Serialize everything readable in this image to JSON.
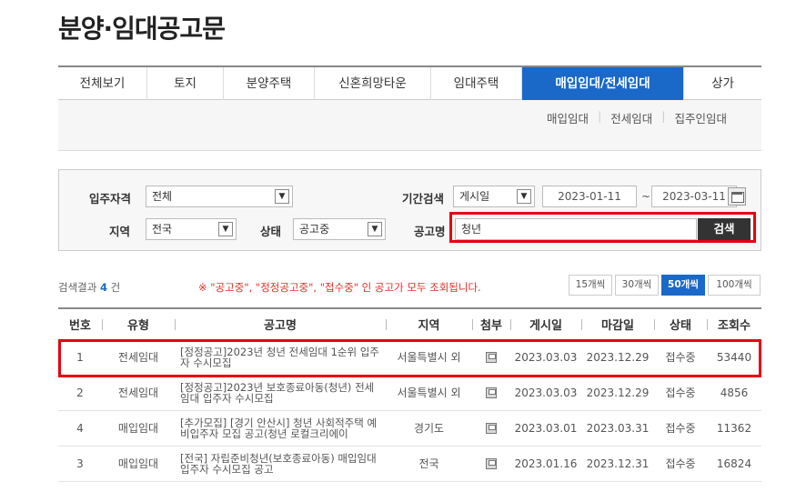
{
  "page_title": "분양·임대공고문",
  "tabs": [
    {
      "label": "전체보기"
    },
    {
      "label": "토지"
    },
    {
      "label": "분양주택"
    },
    {
      "label": "신혼희망타운"
    },
    {
      "label": "임대주택"
    },
    {
      "label": "매입임대/전세임대",
      "active": true
    },
    {
      "label": "상가"
    }
  ],
  "subnav": [
    "매입임대",
    "전세임대",
    "집주인임대"
  ],
  "search": {
    "qualification_label": "입주자격",
    "qualification_value": "전체",
    "period_label": "기간검색",
    "period_type": "게시일",
    "date_from": "2023-01-11",
    "date_sep": "~",
    "date_to": "2023-03-11",
    "region_label": "지역",
    "region_value": "전국",
    "status_label": "상태",
    "status_value": "공고중",
    "keyword_label": "공고명",
    "keyword_value": "청년",
    "button_label": "검색"
  },
  "results": {
    "count_prefix": "검색결과",
    "count": "4",
    "count_suffix": "건",
    "notice": "※ \"공고중\", \"정정공고중\", \"접수중\" 인 공고가 모두 조회됩니다.",
    "per_page": [
      {
        "label": "15개씩"
      },
      {
        "label": "30개씩"
      },
      {
        "label": "50개씩",
        "active": true
      },
      {
        "label": "100개씩"
      }
    ]
  },
  "table": {
    "headers": [
      "번호",
      "유형",
      "공고명",
      "지역",
      "첨부",
      "게시일",
      "마감일",
      "상태",
      "조회수"
    ],
    "rows": [
      {
        "no": "1",
        "type": "전세임대",
        "title": "[정정공고]2023년 청년 전세임대 1순위 입주자 수시모집",
        "region": "서울특별시 외",
        "posted": "2023.03.03",
        "deadline": "2023.12.29",
        "status": "접수중",
        "views": "53440"
      },
      {
        "no": "2",
        "type": "전세임대",
        "title": "[정정공고]2023년 보호종료아동(청년) 전세임대 입주자 수시모집",
        "region": "서울특별시 외",
        "posted": "2023.03.03",
        "deadline": "2023.12.29",
        "status": "접수중",
        "views": "4856"
      },
      {
        "no": "4",
        "type": "매입임대",
        "title": "[추가모집] [경기 안산시] 청년 사회적주택 예비입주자 모집 공고(청년 로컬크리에이",
        "region": "경기도",
        "posted": "2023.03.01",
        "deadline": "2023.03.31",
        "status": "접수중",
        "views": "11362"
      },
      {
        "no": "3",
        "type": "매입임대",
        "title": "[전국] 자립준비청년(보호종료아동) 매입임대 입주자 수시모집 공고",
        "region": "전국",
        "posted": "2023.01.16",
        "deadline": "2023.12.31",
        "status": "접수중",
        "views": "16824"
      }
    ]
  },
  "colors": {
    "accent": "#1a68c8",
    "highlight": "#e60012",
    "notice": "#e0302a"
  }
}
